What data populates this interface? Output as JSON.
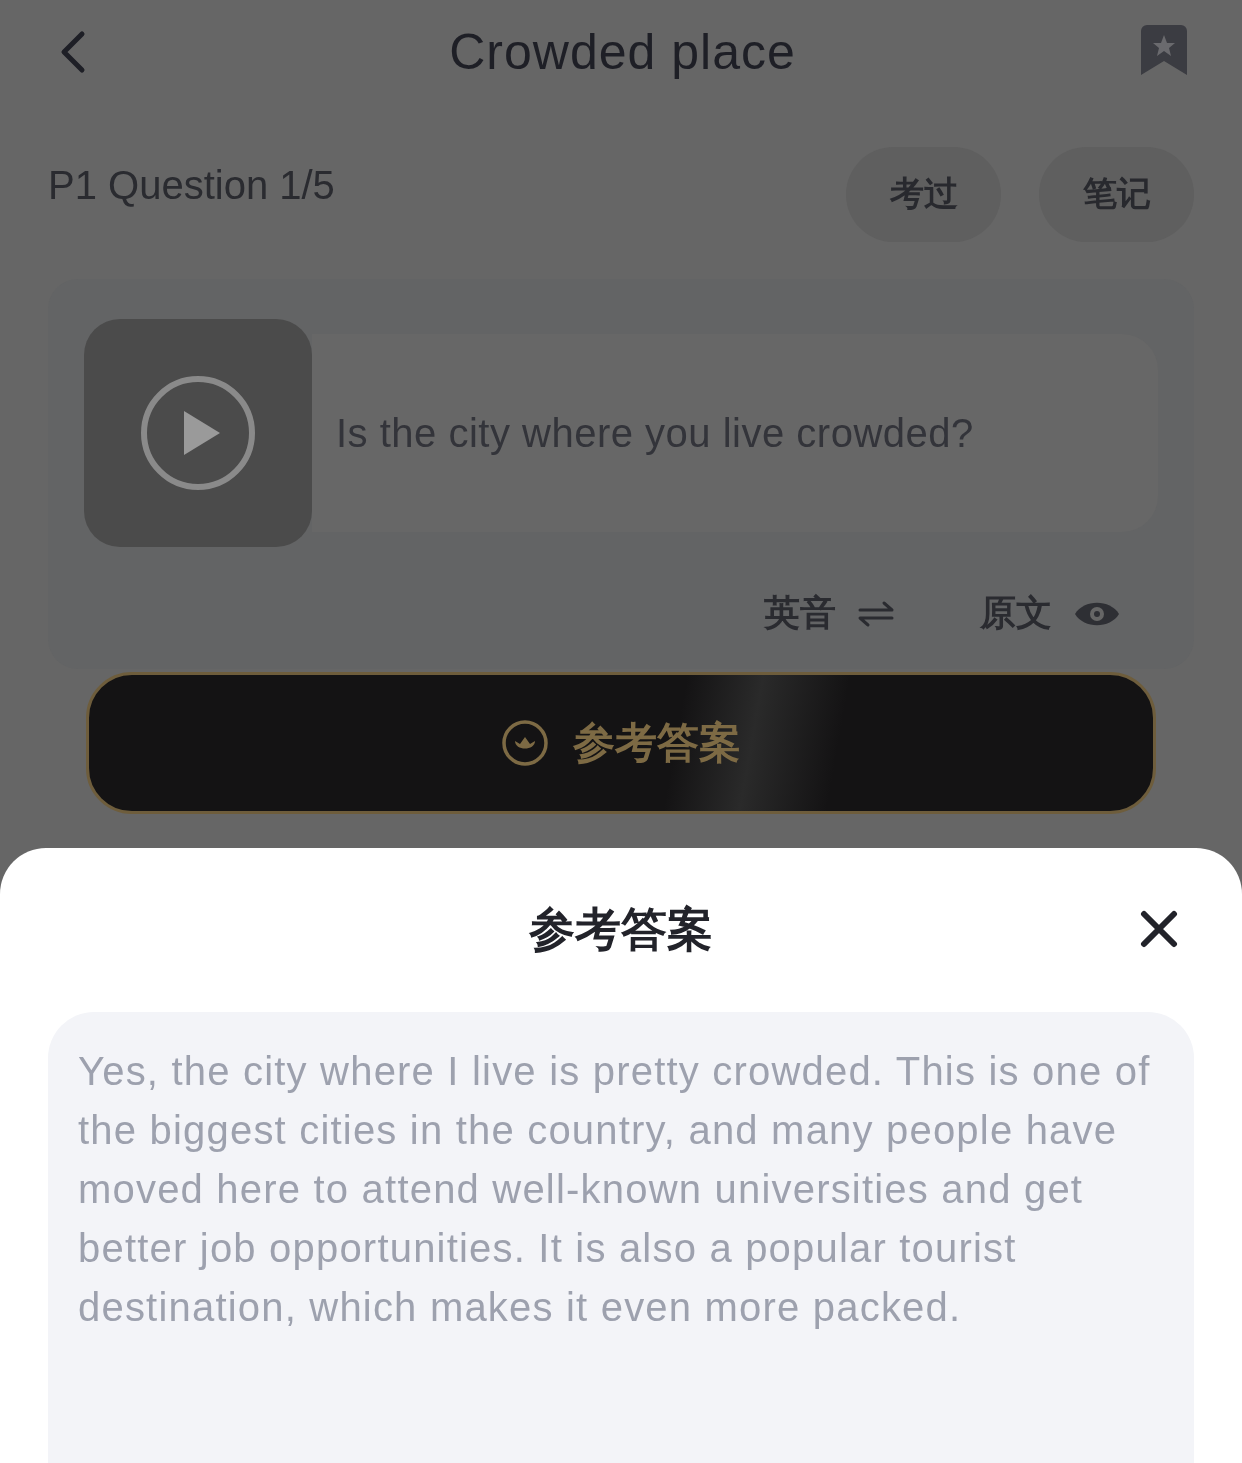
{
  "header": {
    "title": "Crowded place"
  },
  "question_label": "P1 Question 1/5",
  "actions": [
    {
      "label": "考过"
    },
    {
      "label": "笔记"
    }
  ],
  "question": {
    "text": "Is the city where you live crowded?"
  },
  "options": [
    {
      "label": "英音",
      "kind": "swap"
    },
    {
      "label": "原文",
      "kind": "eye"
    }
  ],
  "answer_button": "参考答案",
  "sheet": {
    "title": "参考答案",
    "answer": "Yes, the city where I live is pretty crowded. This is one of the biggest cities in the country, and many people have moved here to attend well-known universities and get better job opportunities. It is also a popular tourist destination, which makes it even more packed."
  }
}
